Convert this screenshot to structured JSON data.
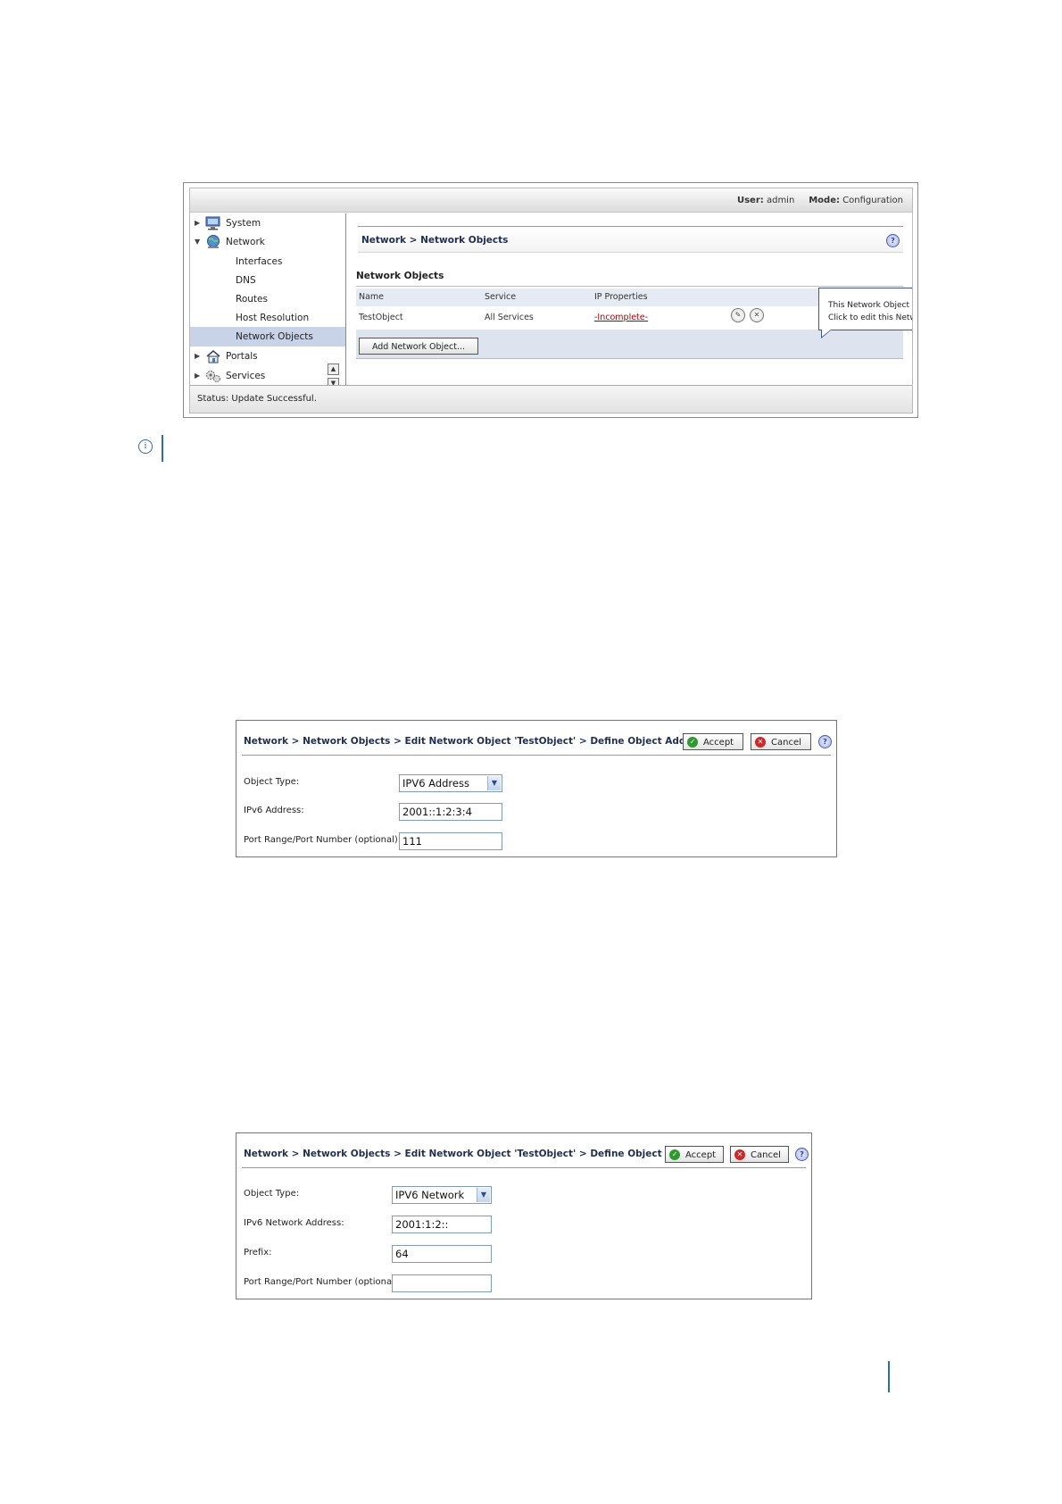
{
  "shot1": {
    "topbar": {
      "user_label": "User:",
      "user_value": "admin",
      "mode_label": "Mode:",
      "mode_value": "Configuration"
    },
    "sidebar": {
      "items": [
        {
          "label": "System",
          "icon": "monitor-icon",
          "expander": "▶"
        },
        {
          "label": "Network",
          "icon": "globe-icon",
          "expander": "▼"
        },
        {
          "label": "Interfaces"
        },
        {
          "label": "DNS"
        },
        {
          "label": "Routes"
        },
        {
          "label": "Host Resolution"
        },
        {
          "label": "Network Objects",
          "selected": true
        },
        {
          "label": "Portals",
          "icon": "house-icon",
          "expander": "▶"
        },
        {
          "label": "Services",
          "icon": "gears-icon",
          "expander": "▶"
        }
      ]
    },
    "breadcrumb": "Network > Network Objects",
    "section_title": "Network Objects",
    "table": {
      "headers": [
        "Name",
        "Service",
        "IP Properties"
      ],
      "row": {
        "name": "TestObject",
        "service": "All Services",
        "ip_properties": "-Incomplete-"
      }
    },
    "tooltip": {
      "line1": "This Network Object is incomplete.",
      "line2": "Click to edit this Network Object"
    },
    "add_button": "Add Network Object...",
    "status": {
      "label": "Status:",
      "value": "Update Successful."
    }
  },
  "dialog1": {
    "title": "Network > Network Objects > Edit Network Object 'TestObject' > Define Object Address",
    "accept": "Accept",
    "cancel": "Cancel",
    "fields": [
      {
        "label": "Object Type:",
        "value": "IPV6 Address",
        "type": "select"
      },
      {
        "label": "IPv6 Address:",
        "value": "2001::1:2:3:4",
        "type": "text"
      },
      {
        "label": "Port Range/Port Number (optional):",
        "value": "111",
        "type": "text"
      }
    ]
  },
  "dialog2": {
    "title": "Network > Network Objects > Edit Network Object 'TestObject' > Define Object Address",
    "accept": "Accept",
    "cancel": "Cancel",
    "fields": [
      {
        "label": "Object Type:",
        "value": "IPV6 Network",
        "type": "select"
      },
      {
        "label": "IPv6 Network Address:",
        "value": "2001:1:2::",
        "type": "text"
      },
      {
        "label": "Prefix:",
        "value": "64",
        "type": "text"
      },
      {
        "label": "Port Range/Port Number (optional):",
        "value": "",
        "type": "text"
      }
    ]
  },
  "note_icon": "info-icon"
}
